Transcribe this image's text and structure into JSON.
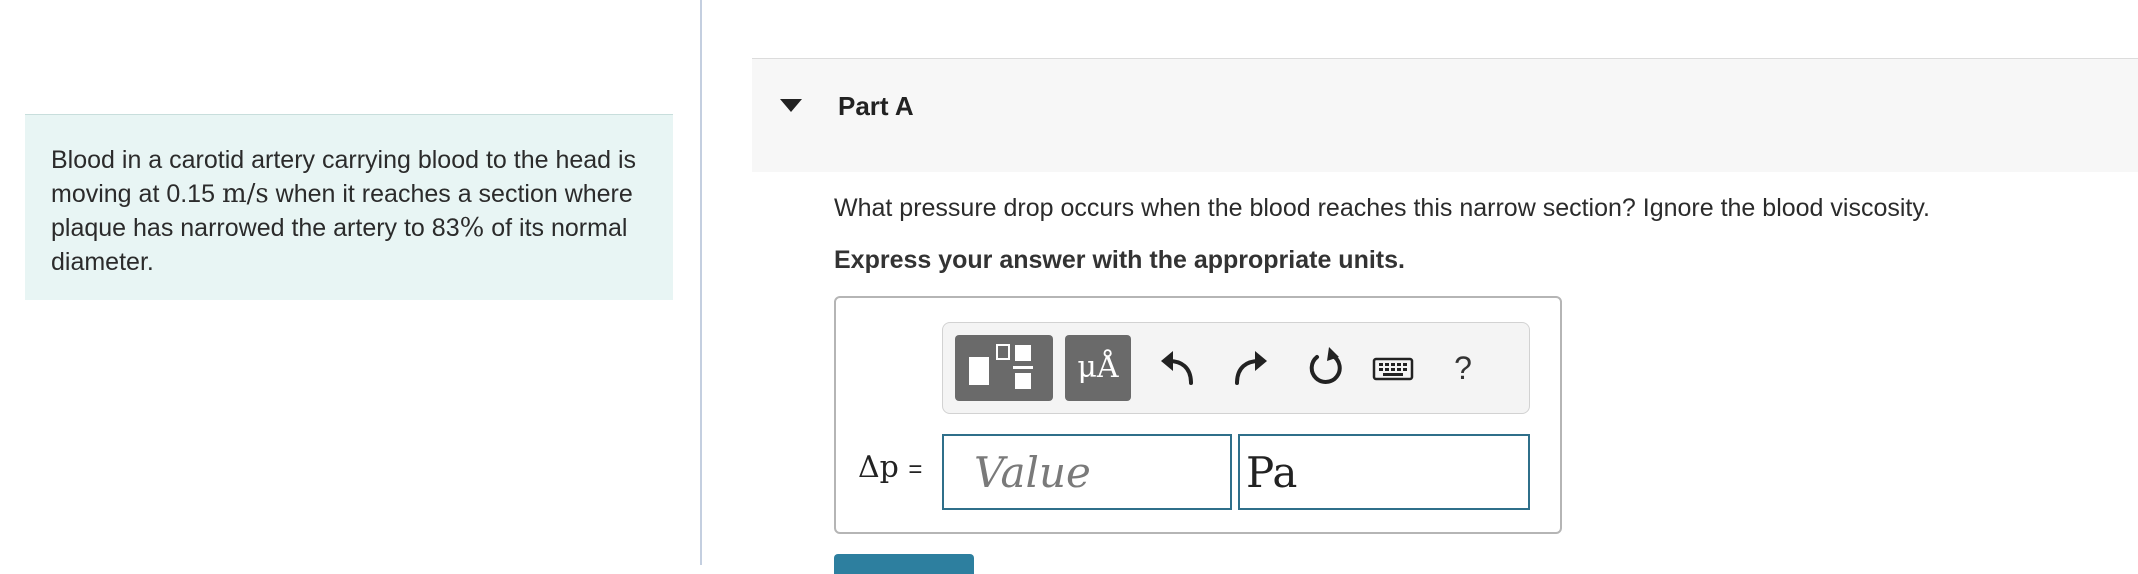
{
  "problem": {
    "segments": [
      {
        "text": "Blood in a carotid artery carrying blood to the head is moving at 0.15 ",
        "math": false
      },
      {
        "text": "m/s",
        "math": true
      },
      {
        "text": " when it reaches a section where plaque has narrowed the artery to 83",
        "math": false
      },
      {
        "text": "%",
        "math": true
      },
      {
        "text": " of its normal diameter.",
        "math": false
      }
    ]
  },
  "part": {
    "title": "Part A"
  },
  "question": "What pressure drop occurs when the blood reaches this narrow section? Ignore the blood viscosity.",
  "instruction": "Express your answer with the appropriate units.",
  "toolbar": {
    "units_label": "μÅ",
    "help_label": "?",
    "icons": [
      "templates-icon",
      "units-icon",
      "undo-icon",
      "redo-icon",
      "reset-icon",
      "keyboard-icon",
      "help-icon"
    ]
  },
  "answer": {
    "variable": "Δp",
    "equals": "=",
    "value_placeholder": "Value",
    "unit_value": "Pa"
  },
  "colors": {
    "problem_bg": "#e8f5f4",
    "input_border": "#2f6f8a",
    "button_gray": "#6a6a6a",
    "submit": "#2d7f9f"
  }
}
